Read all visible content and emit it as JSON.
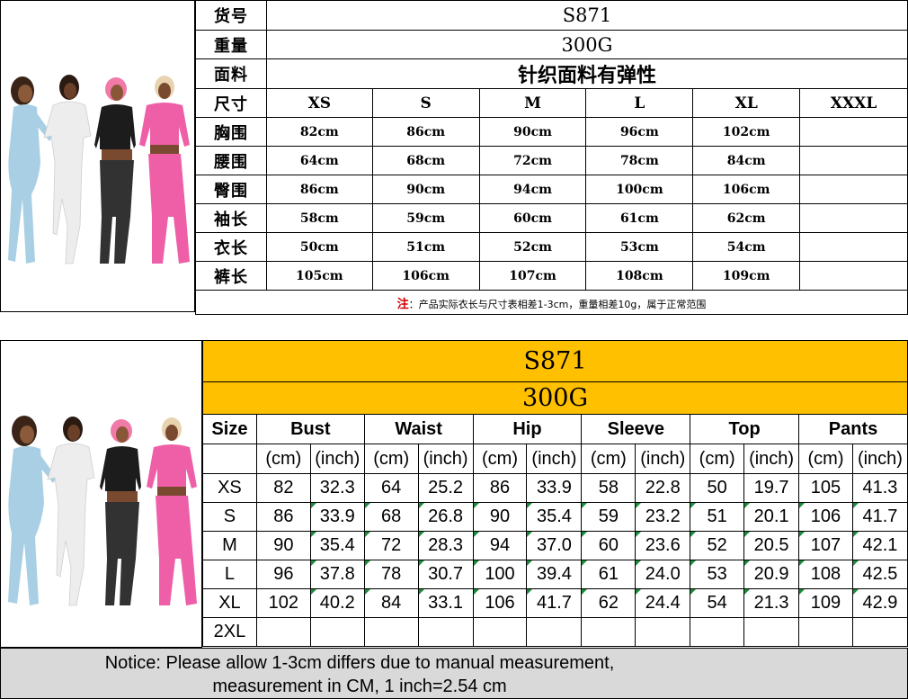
{
  "cn_table": {
    "rows_header": [
      "货号",
      "重量",
      "面料",
      "尺寸",
      "胸围",
      "腰围",
      "臀围",
      "袖长",
      "衣长",
      "裤长"
    ],
    "item_no": "S871",
    "weight": "300G",
    "fabric": "针织面料有弹性",
    "sizes": [
      "XS",
      "S",
      "M",
      "L",
      "XL",
      "XXXL"
    ],
    "measurements": [
      [
        "82cm",
        "86cm",
        "90cm",
        "96cm",
        "102cm",
        ""
      ],
      [
        "64cm",
        "68cm",
        "72cm",
        "78cm",
        "84cm",
        ""
      ],
      [
        "86cm",
        "90cm",
        "94cm",
        "100cm",
        "106cm",
        ""
      ],
      [
        "58cm",
        "59cm",
        "60cm",
        "61cm",
        "62cm",
        ""
      ],
      [
        "50cm",
        "51cm",
        "52cm",
        "53cm",
        "54cm",
        ""
      ],
      [
        "105cm",
        "106cm",
        "107cm",
        "108cm",
        "109cm",
        ""
      ]
    ],
    "note_mark": "注",
    "note_text": "：产品实际衣长与尺寸表相差1-3cm，重量相差10g，属于正常范围"
  },
  "en_table": {
    "item_no": "S871",
    "weight": "300G",
    "size_label": "Size",
    "headers": [
      "Bust",
      "Waist",
      "Hip",
      "Sleeve",
      "Top",
      "Pants"
    ],
    "unit_cm": "(cm)",
    "unit_inch": "(inch)",
    "rows": [
      {
        "size": "XS",
        "values": [
          "82",
          "32.3",
          "64",
          "25.2",
          "86",
          "33.9",
          "58",
          "22.8",
          "50",
          "19.7",
          "105",
          "41.3"
        ]
      },
      {
        "size": "S",
        "values": [
          "86",
          "33.9",
          "68",
          "26.8",
          "90",
          "35.4",
          "59",
          "23.2",
          "51",
          "20.1",
          "106",
          "41.7"
        ]
      },
      {
        "size": "M",
        "values": [
          "90",
          "35.4",
          "72",
          "28.3",
          "94",
          "37.0",
          "60",
          "23.6",
          "52",
          "20.5",
          "107",
          "42.1"
        ]
      },
      {
        "size": "L",
        "values": [
          "96",
          "37.8",
          "78",
          "30.7",
          "100",
          "39.4",
          "61",
          "24.0",
          "53",
          "20.9",
          "108",
          "42.5"
        ]
      },
      {
        "size": "XL",
        "values": [
          "102",
          "40.2",
          "84",
          "33.1",
          "106",
          "41.7",
          "62",
          "24.4",
          "54",
          "21.3",
          "109",
          "42.9"
        ]
      },
      {
        "size": "2XL",
        "values": [
          "",
          "",
          "",
          "",
          "",
          "",
          "",
          "",
          "",
          "",
          "",
          ""
        ]
      }
    ],
    "notice_line1": "Notice: Please allow 1-3cm differs due to manual measurement,",
    "notice_line2": "measurement in CM, 1 inch=2.54 cm"
  },
  "colors": {
    "header_yellow": "#ffc000",
    "notice_gray": "#d9d9d9",
    "note_red": "#d40000",
    "model_blue": "#a9cfe4",
    "model_white": "#ededed",
    "model_black": "#1c1c1c",
    "model_pink": "#ee5fa8"
  }
}
